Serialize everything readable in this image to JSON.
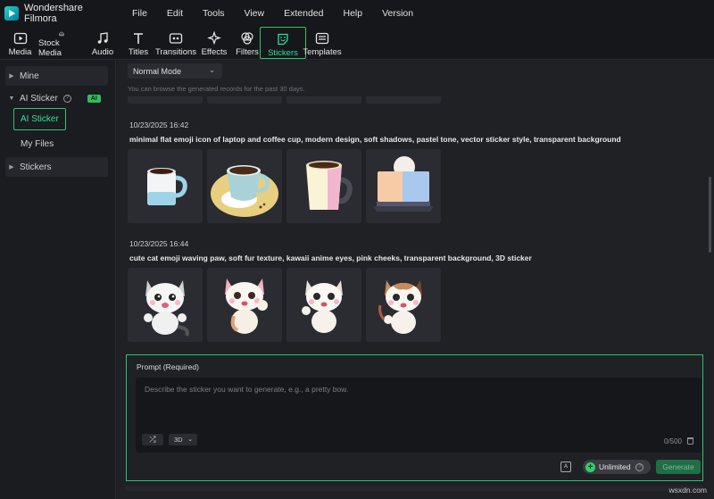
{
  "app": {
    "name": "Wondershare Filmora"
  },
  "menu": [
    "File",
    "Edit",
    "Tools",
    "View",
    "Extended",
    "Help",
    "Version"
  ],
  "toolbar": {
    "tabs": [
      {
        "label": "Media",
        "icon": "media-icon"
      },
      {
        "label": "Stock Media",
        "icon": "stock-media-icon"
      },
      {
        "label": "Audio",
        "icon": "audio-icon"
      },
      {
        "label": "Titles",
        "icon": "titles-icon"
      },
      {
        "label": "Transitions",
        "icon": "transitions-icon"
      },
      {
        "label": "Effects",
        "icon": "effects-icon"
      },
      {
        "label": "Filters",
        "icon": "filters-icon"
      },
      {
        "label": "Stickers",
        "icon": "stickers-icon",
        "active": true
      },
      {
        "label": "Templates",
        "icon": "templates-icon"
      }
    ]
  },
  "sidebar": {
    "mine": "Mine",
    "ai_sticker": "AI Sticker",
    "ai_badge": "AI",
    "ai_sticker_sub": "AI Sticker",
    "my_files": "My Files",
    "stickers": "Stickers"
  },
  "main": {
    "mode": "Normal Mode",
    "hint": "You can browse the generated records for the past 30 days.",
    "records": [
      {
        "date": "10/23/2025 16:42",
        "prompt": "minimal flat emoji icon of laptop and coffee cup, modern design, soft shadows, pastel tone, vector sticker style, transparent background",
        "thumbs": [
          "coffee-mug-sticker",
          "coffee-cup-saucer-sticker",
          "pastel-mug-sticker",
          "laptop-sticker"
        ]
      },
      {
        "date": "10/23/2025 16:44",
        "prompt": "cute cat emoji waving paw, soft fur texture, kawaii anime eyes, pink cheeks, transparent background, 3D sticker",
        "thumbs": [
          "cat-sticker-1",
          "cat-sticker-2",
          "cat-sticker-3",
          "cat-sticker-4"
        ]
      }
    ]
  },
  "prompt_panel": {
    "label": "Prompt (Required)",
    "placeholder": "Describe the sticker you want to generate, e.g., a pretty bow.",
    "style": "3D",
    "counter": "0/500",
    "unlimited": "Unlimited",
    "generate": "Generate"
  },
  "colors": {
    "accent": "#2ec36f",
    "background": "#1f2125"
  },
  "watermark": "wsxdn.com"
}
